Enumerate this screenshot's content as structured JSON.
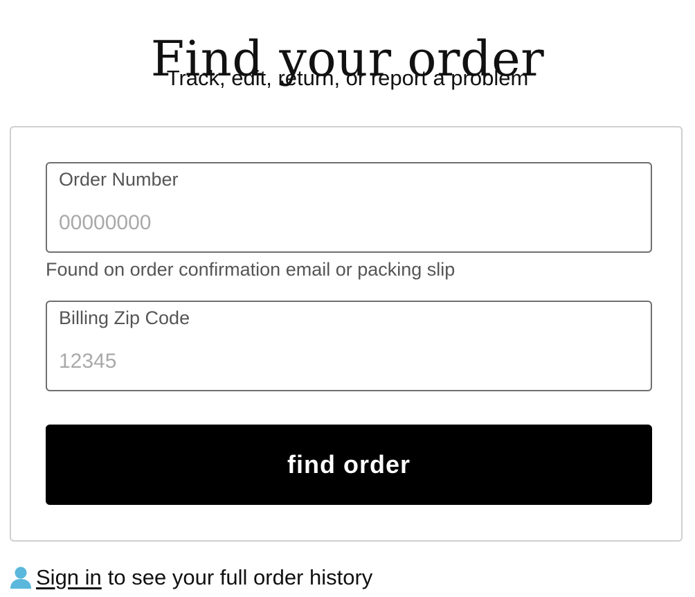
{
  "header": {
    "title": "Find your order",
    "subtitle": "Track, edit, return, or report a problem"
  },
  "form": {
    "order_number": {
      "label": "Order Number",
      "placeholder": "00000000",
      "value": ""
    },
    "order_helper": "Found on order confirmation email or packing slip",
    "zip_code": {
      "label": "Billing Zip Code",
      "placeholder": "12345",
      "value": ""
    },
    "submit_label": "find order"
  },
  "footer": {
    "signin_link": "Sign in",
    "signin_rest": "to see your full order history",
    "icon": "user-icon"
  },
  "colors": {
    "button_bg": "#000000",
    "button_text": "#ffffff",
    "icon_accent": "#5bb8dc",
    "field_border": "#6f6f6f",
    "card_border": "#cfcfcf"
  }
}
